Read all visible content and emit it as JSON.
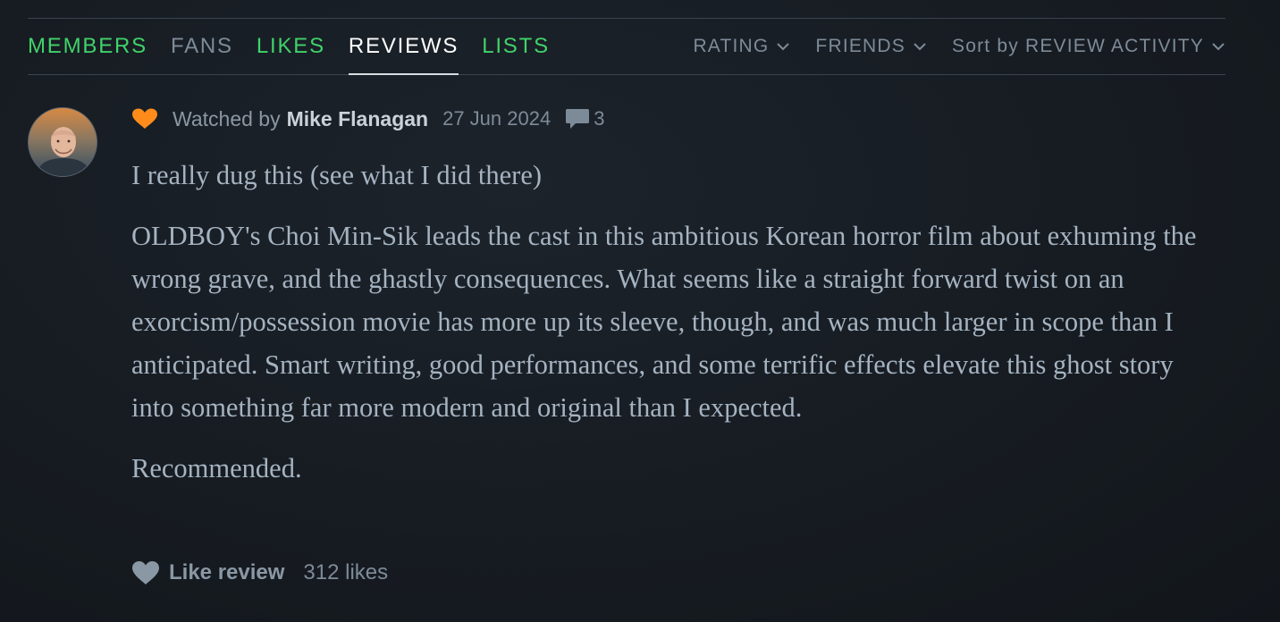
{
  "nav": {
    "tabs": [
      {
        "label": "MEMBERS",
        "state": "link"
      },
      {
        "label": "FANS",
        "state": "muted"
      },
      {
        "label": "LIKES",
        "state": "link"
      },
      {
        "label": "REVIEWS",
        "state": "active"
      },
      {
        "label": "LISTS",
        "state": "link"
      }
    ],
    "filters": {
      "rating": "RATING",
      "friends": "FRIENDS",
      "sort": "Sort by REVIEW ACTIVITY"
    }
  },
  "review": {
    "avatar_icon": "user-avatar",
    "liked_icon": "heart-icon",
    "liked_color": "#ff8c1a",
    "watched_by": "Watched by",
    "username": "Mike Flanagan",
    "date": "27 Jun 2024",
    "comment_icon": "comment-icon",
    "comment_count": "3",
    "paragraphs": {
      "p0": "I really dug this (see what I did there)",
      "p1": "OLDBOY's Choi Min-Sik leads the cast in this ambitious Korean horror film about exhuming the wrong grave, and the ghastly consequences. What seems like a straight forward twist on an exorcism/possession movie has more up its sleeve, though, and was much larger in scope than I anticipated. Smart writing, good performances, and some terrific effects elevate this ghost story into something far more modern and original than I expected.",
      "p2": "Recommended."
    },
    "like_label": "Like review",
    "likes_count": "312 likes"
  },
  "colors": {
    "background": "#161b21",
    "link_green": "#40d36a",
    "muted": "#7d8b99",
    "body_text": "#a5b3c1",
    "heart_orange": "#ff8c1a"
  }
}
